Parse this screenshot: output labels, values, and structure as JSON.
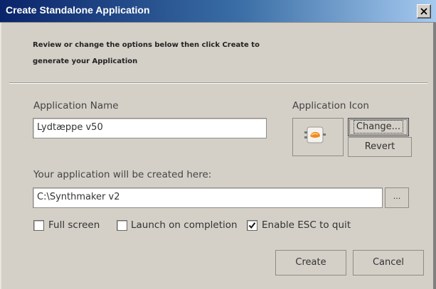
{
  "window": {
    "title": "Create Standalone Application",
    "close_icon": "close-icon"
  },
  "intro": {
    "line1": "Review or change the options below then click Create to",
    "line2": "generate your Application"
  },
  "app_name": {
    "label": "Application Name",
    "value": "Lydtæppe v50"
  },
  "app_icon": {
    "label": "Application Icon",
    "icon": "app-icon",
    "change_label": "Change...",
    "revert_label": "Revert"
  },
  "location": {
    "label": "Your application will be created here:",
    "value": "C:\\Synthmaker v2",
    "browse_label": "..."
  },
  "options": [
    {
      "label": "Full screen",
      "checked": false
    },
    {
      "label": "Launch on completion",
      "checked": false
    },
    {
      "label": "Enable ESC to quit",
      "checked": true
    }
  ],
  "actions": {
    "create_label": "Create",
    "cancel_label": "Cancel"
  },
  "colors": {
    "title_bar_start": "#0a246a",
    "title_bar_end": "#a6caf0",
    "dialog_bg": "#d4d0c8"
  }
}
